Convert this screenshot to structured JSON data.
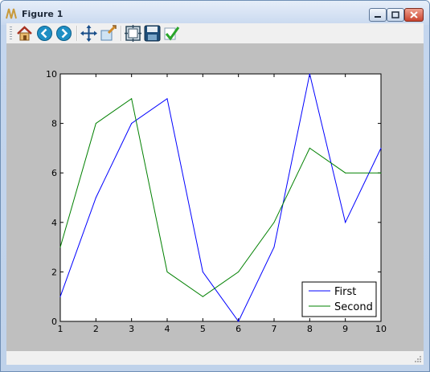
{
  "window": {
    "title": "Figure 1"
  },
  "toolbar": {
    "buttons": [
      {
        "icon": "home-icon"
      },
      {
        "icon": "back-icon"
      },
      {
        "icon": "forward-icon"
      },
      {
        "icon": "pan-icon"
      },
      {
        "icon": "zoom-icon"
      },
      {
        "icon": "subplots-icon"
      },
      {
        "icon": "save-icon"
      },
      {
        "icon": "edit-check-icon"
      }
    ]
  },
  "colors": {
    "series_first": "#0000ff",
    "series_second": "#008000",
    "canvas_background": "#bfbfbf"
  },
  "chart_data": {
    "type": "line",
    "title": "",
    "xlabel": "",
    "ylabel": "",
    "x": [
      1,
      2,
      3,
      4,
      5,
      6,
      7,
      8,
      9,
      10
    ],
    "xlim": [
      1,
      10
    ],
    "ylim": [
      0,
      10
    ],
    "xticks": [
      "1",
      "2",
      "3",
      "4",
      "5",
      "6",
      "7",
      "8",
      "9",
      "10"
    ],
    "yticks": [
      "0",
      "2",
      "4",
      "6",
      "8",
      "10"
    ],
    "grid": false,
    "legend_position": "lower-right",
    "series": [
      {
        "name": "First",
        "values": [
          1,
          5,
          8,
          9,
          2,
          0,
          3,
          10,
          4,
          7
        ]
      },
      {
        "name": "Second",
        "values": [
          3,
          8,
          9,
          2,
          1,
          2,
          4,
          7,
          6,
          6
        ]
      }
    ]
  }
}
